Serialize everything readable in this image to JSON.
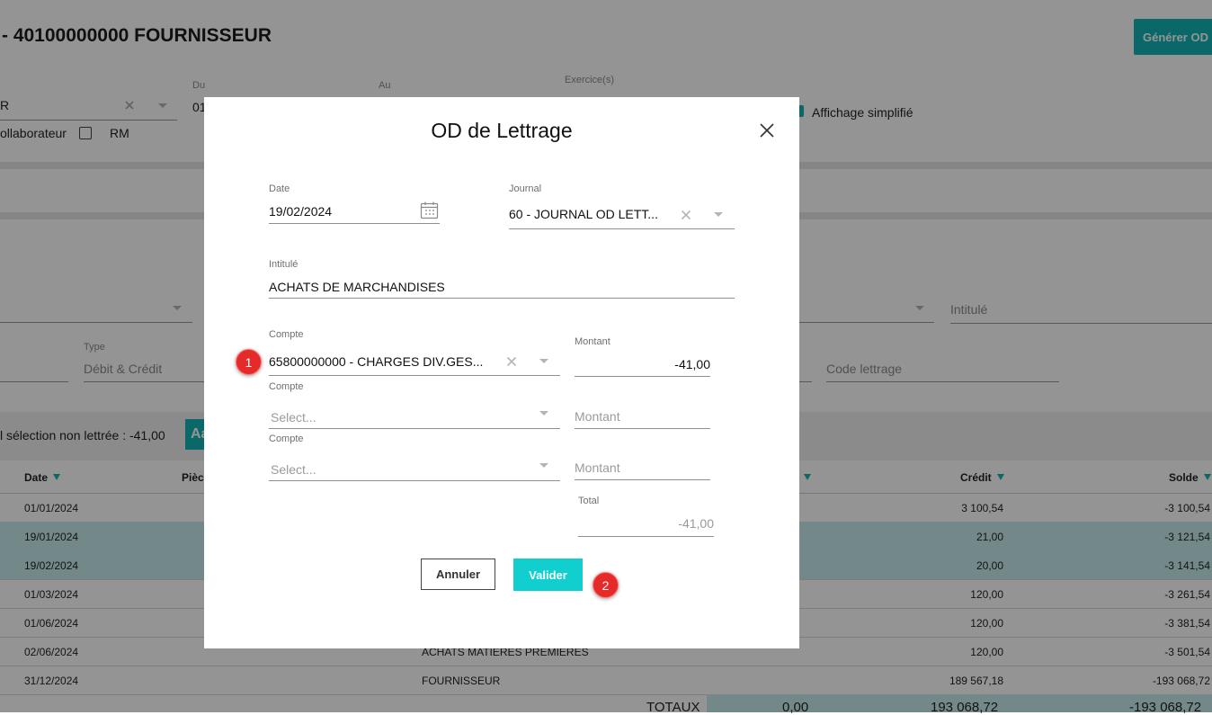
{
  "page": {
    "title": "- 40100000000 FOURNISSEUR",
    "generate_button": "Générer OD",
    "filters": {
      "first_value": "R",
      "du_label": "Du",
      "du_value": "01",
      "au_label": "Au",
      "exercices_label": "Exercice(s)",
      "collaborateur_label": "ollaborateur",
      "rm_label": "RM",
      "affichage_label": "Affichage simplifié",
      "intitule_placeholder": "Intitulé",
      "type_label": "Type",
      "type_value": "Débit & Crédit",
      "code_lettrage_placeholder": "Code lettrage"
    },
    "selection_text": "l sélection non lettrée : -41,00",
    "selection_button": "Aa"
  },
  "table": {
    "headers": {
      "date": "Date",
      "piece": "Pièce",
      "debit_partial": "t",
      "credit": "Crédit",
      "solde": "Solde"
    },
    "rows": [
      {
        "date": "01/01/2024",
        "label": "",
        "credit": "3 100,54",
        "solde": "-3 100,54",
        "selected": false
      },
      {
        "date": "19/01/2024",
        "label": "",
        "credit": "21,00",
        "solde": "-3 121,54",
        "selected": true
      },
      {
        "date": "19/02/2024",
        "label": "",
        "credit": "20,00",
        "solde": "-3 141,54",
        "selected": true
      },
      {
        "date": "01/03/2024",
        "label": "",
        "credit": "120,00",
        "solde": "-3 261,54",
        "selected": false
      },
      {
        "date": "01/06/2024",
        "label": "",
        "credit": "120,00",
        "solde": "-3 381,54",
        "selected": false
      },
      {
        "date": "02/06/2024",
        "label": "ACHATS MATIERES PREMIERES",
        "credit": "120,00",
        "solde": "-3 501,54",
        "selected": false
      },
      {
        "date": "31/12/2024",
        "label": "FOURNISSEUR",
        "credit": "189 567,18",
        "solde": "-193 068,72",
        "selected": false
      }
    ],
    "totals": {
      "label": "TOTAUX",
      "debit": "0,00",
      "credit": "193 068,72",
      "solde": "-193 068,72"
    }
  },
  "modal": {
    "title": "OD de Lettrage",
    "date_label": "Date",
    "date_value": "19/02/2024",
    "journal_label": "Journal",
    "journal_value": "60 - JOURNAL OD LETT...",
    "intitule_label": "Intitulé",
    "intitule_value": "ACHATS DE MARCHANDISES",
    "lines": [
      {
        "compte_label": "Compte",
        "compte_value": "65800000000 - CHARGES DIV.GES...",
        "montant_label": "Montant",
        "montant_value": "-41,00"
      },
      {
        "compte_label": "Compte",
        "compte_placeholder": "Select...",
        "montant_placeholder": "Montant"
      },
      {
        "compte_label": "Compte",
        "compte_placeholder": "Select...",
        "montant_placeholder": "Montant"
      }
    ],
    "total_label": "Total",
    "total_value": "-41,00",
    "cancel_button": "Annuler",
    "validate_button": "Valider"
  },
  "markers": [
    "1",
    "2"
  ],
  "colors": {
    "accent": "#12b3b3",
    "valider": "#12cfcf",
    "marker": "#e52a2a",
    "selected_row": "#c7ecec"
  }
}
